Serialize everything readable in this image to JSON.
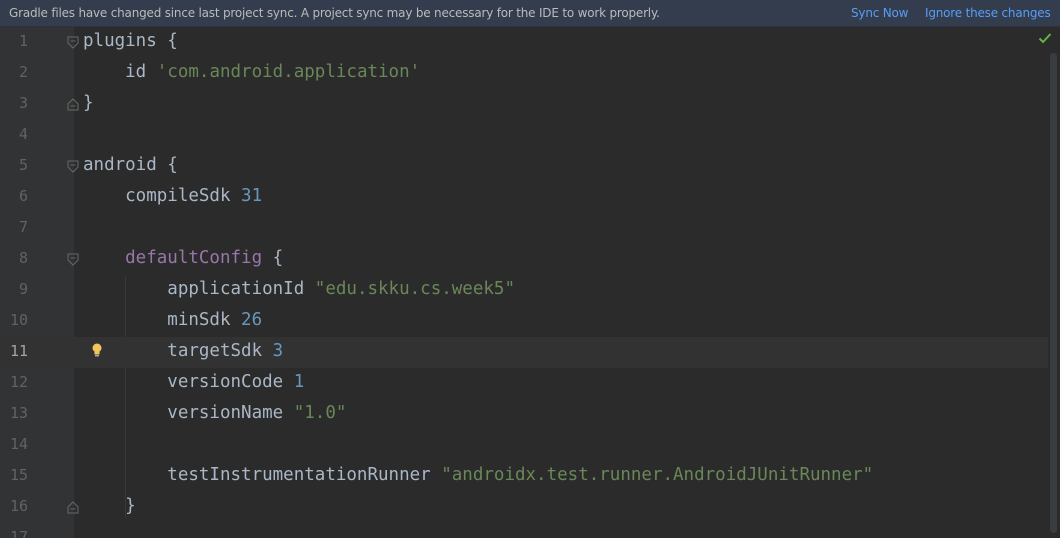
{
  "banner": {
    "message": "Gradle files have changed since last project sync. A project sync may be necessary for the IDE to work properly.",
    "sync_now": "Sync Now",
    "ignore": "Ignore these changes"
  },
  "editor": {
    "current_line": 11,
    "inspection_status": "check-icon",
    "lines": [
      {
        "n": "1",
        "t1": "plugins {"
      },
      {
        "n": "2",
        "t1": "    id ",
        "t2": "'com.android.application'"
      },
      {
        "n": "3",
        "t1": "}"
      },
      {
        "n": "4"
      },
      {
        "n": "5",
        "t1": "android {"
      },
      {
        "n": "6",
        "t1": "    compileSdk ",
        "t2": "31"
      },
      {
        "n": "7"
      },
      {
        "n": "8",
        "t1": "    defaultConfig",
        "t2": " {"
      },
      {
        "n": "9",
        "t1": "        applicationId ",
        "t2": "\"edu.skku.cs.week5\""
      },
      {
        "n": "10",
        "t1": "        minSdk ",
        "t2": "26"
      },
      {
        "n": "11",
        "t1": "        targetSdk ",
        "t2": "3"
      },
      {
        "n": "12",
        "t1": "        versionCode ",
        "t2": "1"
      },
      {
        "n": "13",
        "t1": "        versionName ",
        "t2": "\"1.0\""
      },
      {
        "n": "14"
      },
      {
        "n": "15",
        "t1": "        testInstrumentationRunner ",
        "t2": "\"androidx.test.runner.AndroidJUnitRunner\""
      },
      {
        "n": "16",
        "t1": "    }"
      },
      {
        "n": "17"
      }
    ]
  },
  "colors": {
    "background": "#2b2b2b",
    "banner": "#333d4d",
    "link": "#589df6",
    "string": "#6a8759",
    "number": "#6897bb",
    "property": "#9876aa",
    "text": "#a9b7c6"
  }
}
